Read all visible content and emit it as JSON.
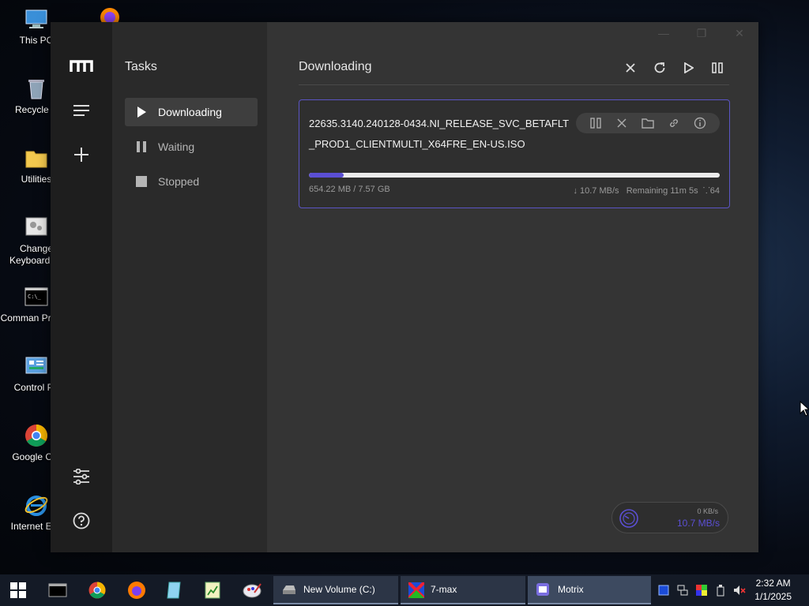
{
  "desktop": {
    "icons": [
      {
        "label": "This PC"
      },
      {
        "label": "Recycle B"
      },
      {
        "label": "Utilities"
      },
      {
        "label": "Change Keyboard La"
      },
      {
        "label": "Comman Prompt"
      },
      {
        "label": "Control Pa"
      },
      {
        "label": "Google Chr"
      },
      {
        "label": "Internet Exp"
      }
    ]
  },
  "app": {
    "sidebar": {
      "logo_icon": "motrix-logo-icon",
      "menu_icon": "hamburger-icon",
      "add_icon": "plus-icon",
      "settings_icon": "sliders-icon",
      "help_icon": "help-circle-icon"
    },
    "tasks_panel": {
      "title": "Tasks",
      "items": [
        {
          "label": "Downloading",
          "icon": "play-icon",
          "active": true
        },
        {
          "label": "Waiting",
          "icon": "pause-icon",
          "active": false
        },
        {
          "label": "Stopped",
          "icon": "stop-icon",
          "active": false
        }
      ]
    },
    "main": {
      "title": "Downloading",
      "toolbar": [
        "close-icon",
        "refresh-icon",
        "play-icon",
        "pause-icon"
      ],
      "task": {
        "name": "22635.3140.240128-0434.NI_RELEASE_SVC_BETAFLT_PROD1_CLIENTMULTI_X64FRE_EN-US.ISO",
        "progress": 0.0845,
        "size": "654.22 MB / 7.57 GB",
        "speed": "↓ 10.7 MB/s",
        "remaining": "Remaining 11m 5s",
        "connections": "64",
        "actions": [
          "pause-icon",
          "close-icon",
          "folder-icon",
          "link-icon",
          "info-icon"
        ]
      }
    },
    "speedometer": {
      "upload": "0 KB/s",
      "download": "10.7 MB/s"
    },
    "colors": {
      "accent": "#5b4fd4",
      "background": "#343434"
    }
  },
  "taskbar": {
    "apps": [
      {
        "label": "New Volume (C:)"
      },
      {
        "label": "7-max"
      },
      {
        "label": "Motrix"
      }
    ],
    "clock": {
      "time": "2:32 AM",
      "date": "1/1/2025"
    }
  }
}
